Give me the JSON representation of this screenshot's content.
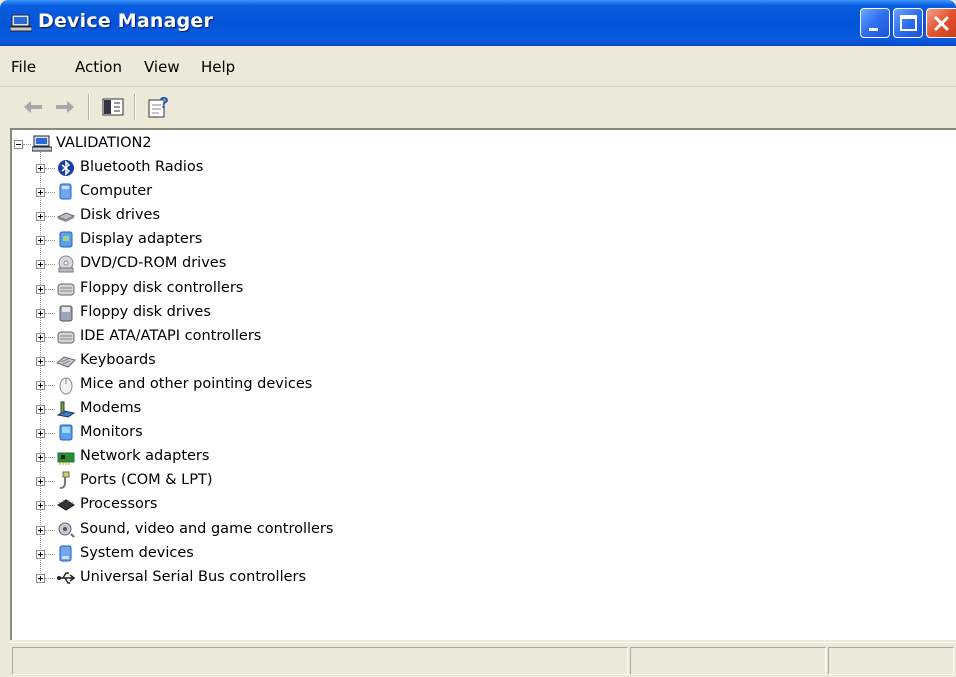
{
  "window": {
    "title": "Device Manager",
    "title_icon": "computer-icon"
  },
  "title_buttons": {
    "minimize": "minimize-icon",
    "maximize": "maximize-icon",
    "close": "close-icon"
  },
  "menu": {
    "file": "File",
    "action": "Action",
    "view": "View",
    "help": "Help"
  },
  "toolbar": {
    "back_icon": "back-arrow-icon",
    "forward_icon": "forward-arrow-icon",
    "show_hide_icon": "show-hide-console-tree-icon",
    "properties_icon": "properties-help-icon"
  },
  "tree": {
    "root": {
      "label": "VALIDATION2",
      "icon": "computer-icon",
      "expanded": true
    },
    "items": [
      {
        "label": "Bluetooth Radios",
        "icon": "bluetooth-icon"
      },
      {
        "label": "Computer",
        "icon": "computer-icon"
      },
      {
        "label": "Disk drives",
        "icon": "disk-drive-icon"
      },
      {
        "label": "Display adapters",
        "icon": "display-adapter-icon"
      },
      {
        "label": "DVD/CD-ROM drives",
        "icon": "cdrom-icon"
      },
      {
        "label": "Floppy disk controllers",
        "icon": "controller-icon"
      },
      {
        "label": "Floppy disk drives",
        "icon": "floppy-icon"
      },
      {
        "label": "IDE ATA/ATAPI controllers",
        "icon": "controller-icon"
      },
      {
        "label": "Keyboards",
        "icon": "keyboard-icon"
      },
      {
        "label": "Mice and other pointing devices",
        "icon": "mouse-icon"
      },
      {
        "label": "Modems",
        "icon": "modem-icon"
      },
      {
        "label": "Monitors",
        "icon": "monitor-icon"
      },
      {
        "label": "Network adapters",
        "icon": "network-adapter-icon"
      },
      {
        "label": "Ports (COM & LPT)",
        "icon": "port-icon"
      },
      {
        "label": "Processors",
        "icon": "processor-icon"
      },
      {
        "label": "Sound, video and game controllers",
        "icon": "sound-icon"
      },
      {
        "label": "System devices",
        "icon": "system-device-icon"
      },
      {
        "label": "Universal Serial Bus controllers",
        "icon": "usb-icon"
      }
    ]
  },
  "colors": {
    "titlebar": "#0454d8",
    "face": "#ece9d8",
    "close_button": "#e4512f"
  }
}
